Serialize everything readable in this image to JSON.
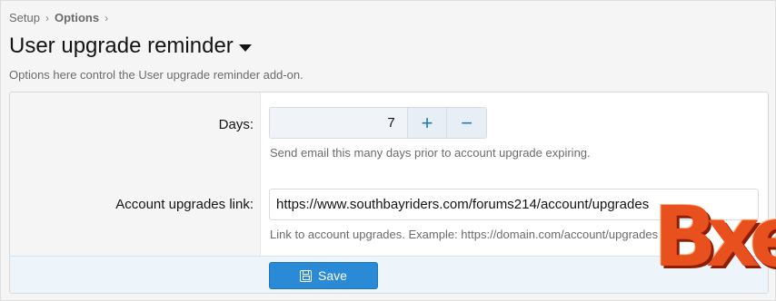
{
  "breadcrumb": {
    "items": [
      "Setup",
      "Options"
    ],
    "separator": "›"
  },
  "page": {
    "title": "User upgrade reminder",
    "description": "Options here control the User upgrade reminder add-on."
  },
  "form": {
    "days": {
      "label": "Days:",
      "value": "7",
      "increment_label": "+",
      "decrement_label": "−",
      "hint": "Send email this many days prior to account upgrade expiring."
    },
    "account_link": {
      "label": "Account upgrades link:",
      "value": "https://www.southbayriders.com/forums214/account/upgrades",
      "hint": "Link to account upgrades. Example: https://domain.com/account/upgrades"
    },
    "save_label": "Save"
  },
  "watermark": {
    "text": "Bxen",
    "color": "#e8501d"
  },
  "colors": {
    "accent": "#2b8ad6",
    "stepper_icon": "#2577b1"
  }
}
